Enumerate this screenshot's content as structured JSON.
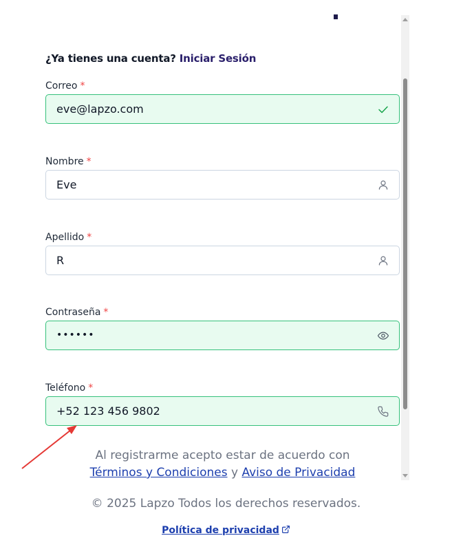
{
  "login_prompt": {
    "question": "¿Ya tienes una cuenta?",
    "link_label": "Iniciar Sesión"
  },
  "required_marker": "*",
  "fields": {
    "email": {
      "label": "Correo",
      "value": "eve@lapzo.com",
      "icon": "check-icon",
      "valid": true
    },
    "first_name": {
      "label": "Nombre",
      "value": "Eve",
      "icon": "user-icon",
      "valid": false
    },
    "last_name": {
      "label": "Apellido",
      "value": "R",
      "icon": "user-icon",
      "valid": false
    },
    "password": {
      "label": "Contraseña",
      "value": "••••••",
      "icon": "eye-icon",
      "valid": true
    },
    "phone": {
      "label": "Teléfono",
      "value": "+52 123 456 9802",
      "icon": "phone-icon",
      "valid": true
    }
  },
  "agreement": {
    "text": "Al registrarme acepto estar de acuerdo con",
    "terms_link": "Términos y Condiciones",
    "connector": "y",
    "privacy_notice_link": "Aviso de Privacidad"
  },
  "footer": {
    "copyright": "© 2025 Lapzo Todos los derechos reservados.",
    "privacy_policy_link": "Política de privacidad"
  },
  "colors": {
    "valid_background": "#e8fbf0",
    "valid_border": "#34c07a",
    "link": "#1d3fae",
    "required": "#ef4444",
    "annotation_arrow": "#e53935"
  }
}
